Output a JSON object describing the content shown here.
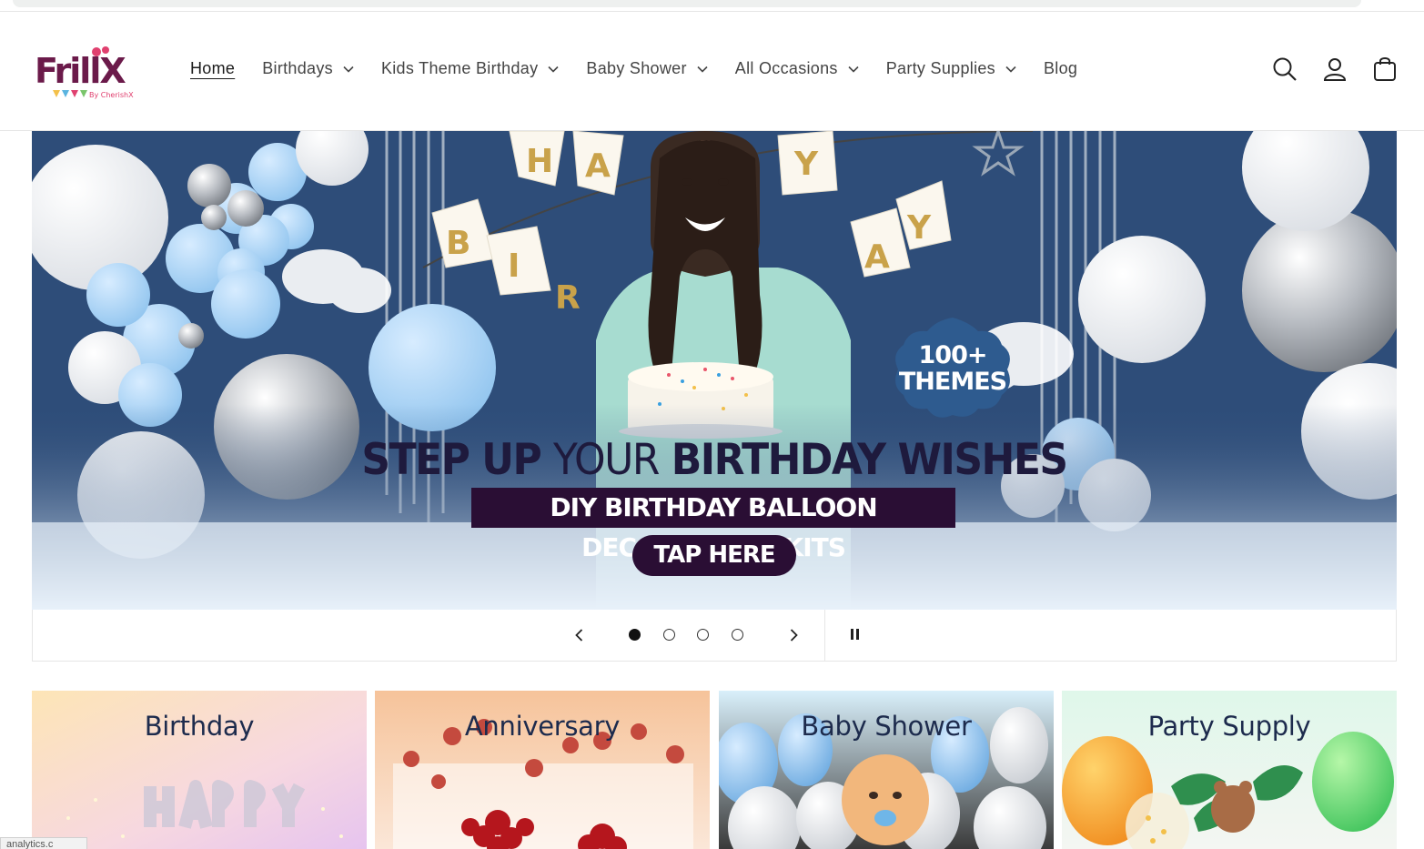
{
  "brand": {
    "logo_text": "FrillX",
    "logo_sub": "By CherishX"
  },
  "nav": {
    "items": [
      {
        "label": "Home",
        "active": true,
        "dropdown": false
      },
      {
        "label": "Birthdays",
        "active": false,
        "dropdown": true
      },
      {
        "label": "Kids Theme Birthday",
        "active": false,
        "dropdown": true
      },
      {
        "label": "Baby Shower",
        "active": false,
        "dropdown": true
      },
      {
        "label": "All Occasions",
        "active": false,
        "dropdown": true
      },
      {
        "label": "Party Supplies",
        "active": false,
        "dropdown": true
      },
      {
        "label": "Blog",
        "active": false,
        "dropdown": false
      }
    ]
  },
  "header_icons": [
    "search-icon",
    "account-icon",
    "cart-icon"
  ],
  "hero": {
    "banner_letters": [
      "H",
      "A",
      "Y",
      "B",
      "I",
      "R",
      "A",
      "Y"
    ],
    "badge_line1": "100+",
    "badge_line2": "THEMES",
    "headline_bold1": "STEP UP",
    "headline_light": "YOUR",
    "headline_bold2": "BIRTHDAY WISHES",
    "subheadline": "DIY BIRTHDAY BALLOON DECORATIONS KITS",
    "cta": "TAP HERE"
  },
  "slider": {
    "slide_count": 4,
    "active_index": 0
  },
  "categories": [
    {
      "title": "Birthday"
    },
    {
      "title": "Anniversary"
    },
    {
      "title": "Baby Shower"
    },
    {
      "title": "Party Supply"
    }
  ],
  "status_tab": "analytics.c",
  "colors": {
    "accent_dark": "#2a0e34",
    "hero_bg": "#2f4f7c",
    "card_title": "#1d2b4d"
  }
}
